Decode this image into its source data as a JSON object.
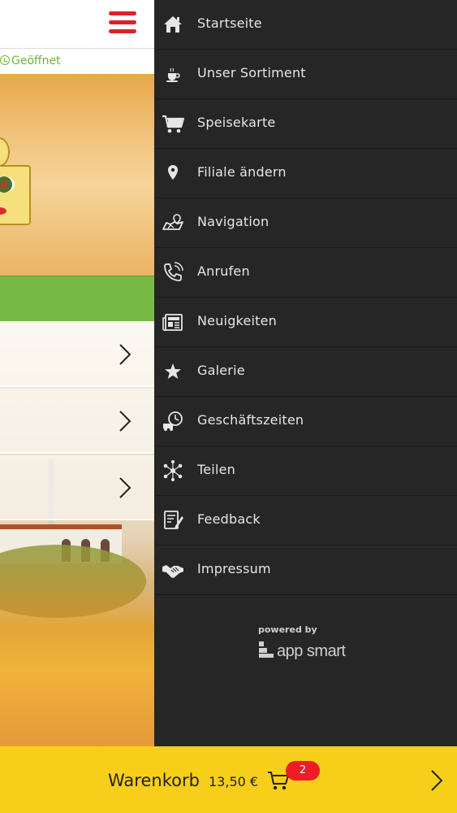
{
  "app": {
    "status_open": "Geöffnet",
    "menu_icon": "hamburger-menu-icon",
    "list_items": [
      {
        "icon": "chevron-right-icon"
      },
      {
        "icon": "chevron-right-icon"
      },
      {
        "icon": "chevron-right-icon"
      }
    ]
  },
  "side_menu": {
    "items": [
      {
        "label": "Startseite",
        "icon": "home-icon"
      },
      {
        "label": "Unser Sortiment",
        "icon": "coffee-cup-icon"
      },
      {
        "label": "Speisekarte",
        "icon": "shopping-cart-icon"
      },
      {
        "label": "Filiale ändern",
        "icon": "map-pin-icon"
      },
      {
        "label": "Navigation",
        "icon": "map-navigation-icon"
      },
      {
        "label": "Anrufen",
        "icon": "phone-icon"
      },
      {
        "label": "Neuigkeiten",
        "icon": "newspaper-icon"
      },
      {
        "label": "Galerie",
        "icon": "star-icon"
      },
      {
        "label": "Geschäftszeiten",
        "icon": "delivery-clock-icon"
      },
      {
        "label": "Teilen",
        "icon": "share-icon"
      },
      {
        "label": "Feedback",
        "icon": "feedback-form-icon"
      },
      {
        "label": "Impressum",
        "icon": "handshake-icon"
      }
    ],
    "powered_by": "powered by",
    "brand": "app smart"
  },
  "cart": {
    "label": "Warenkorb",
    "total": "13,50 €",
    "count": "2",
    "icon": "cart-icon"
  },
  "colors": {
    "accent_red": "#e3202a",
    "menu_bg": "#262626",
    "cart_bar": "#f7cf1a",
    "open_green": "#6db63a",
    "band_green": "#77bb45"
  }
}
